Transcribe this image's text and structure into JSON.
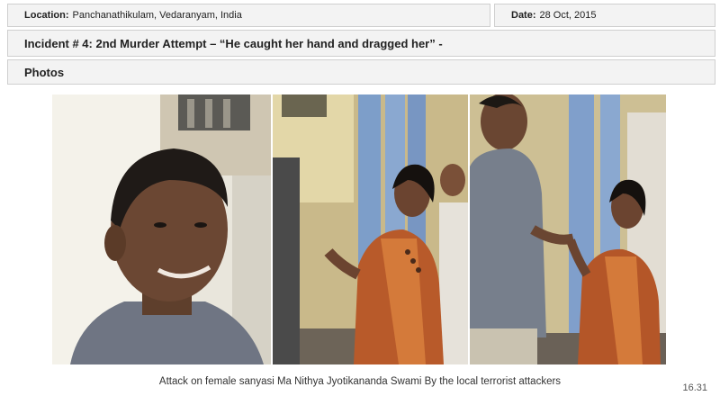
{
  "header": {
    "location_label": "Location:",
    "location_value": "Panchanathikulam, Vedaranyam, India",
    "date_label": "Date:",
    "date_value": "28 Oct, 2015"
  },
  "incident_title": "Incident # 4: 2nd Murder Attempt – “He caught her hand and dragged her” -",
  "section_label": "Photos",
  "caption": "Attack on female sanyasi Ma Nithya Jyotikananda Swami By the local terrorist attackers",
  "page_number": "16.31"
}
